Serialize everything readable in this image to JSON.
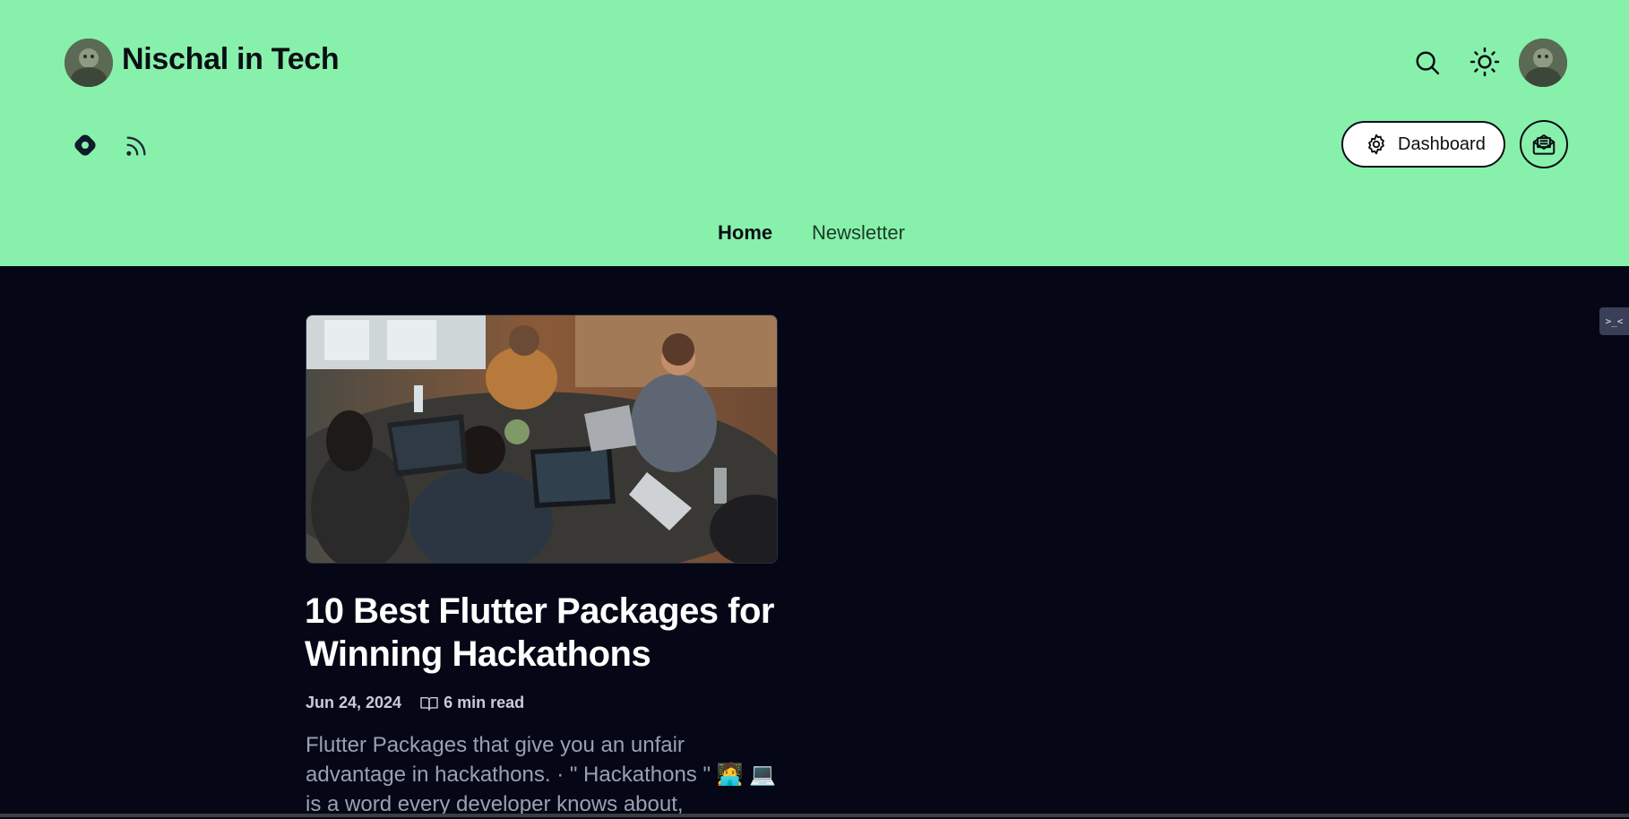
{
  "header": {
    "site_title": "Nischal in Tech",
    "logo_icon": "author-avatar",
    "actions": {
      "search_icon": "search-icon",
      "theme_icon": "sun-icon",
      "profile_icon": "user-avatar"
    },
    "social": [
      "hashnode-icon",
      "rss-icon"
    ],
    "dashboard_label": "Dashboard",
    "newsletter_icon": "mail-open-icon"
  },
  "nav": {
    "items": [
      {
        "label": "Home",
        "active": true
      },
      {
        "label": "Newsletter",
        "active": false
      }
    ]
  },
  "post": {
    "title": "10 Best Flutter Packages for Winning Hackathons",
    "date": "Jun 24, 2024",
    "read_time": "6 min read",
    "excerpt": "Flutter Packages that give you an unfair advantage in hackathons. · \" Hackathons \" 🧑‍💻 💻 is a word every developer knows about,"
  },
  "side_widget": {
    "label": ">_<"
  },
  "colors": {
    "header_bg": "#87f1ab",
    "page_bg": "#050716",
    "title": "#ffffff",
    "excerpt": "#9aa0b4"
  }
}
